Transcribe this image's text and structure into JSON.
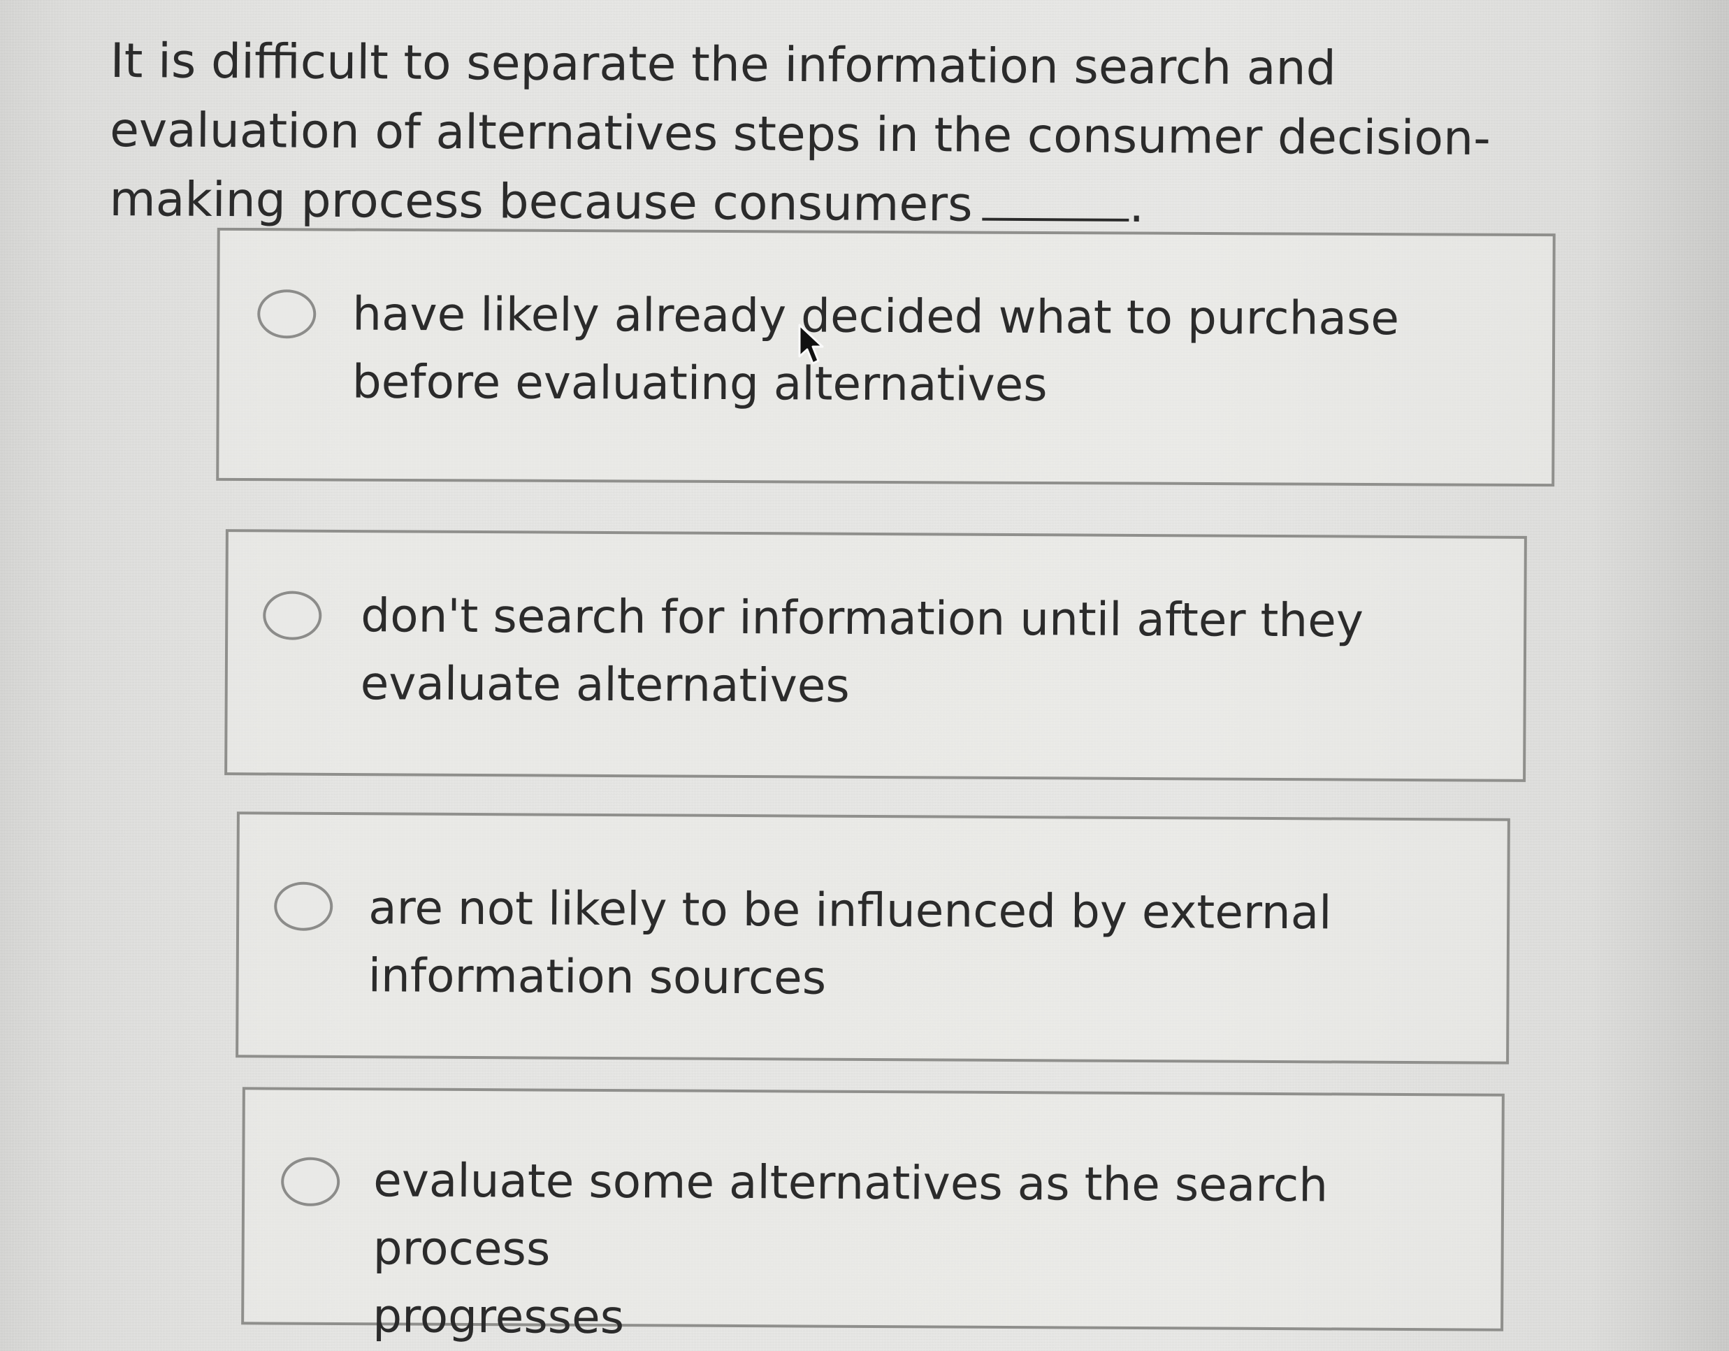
{
  "question": {
    "text": "It is difficult to separate the information search and evaluation of alternatives steps in the consumer decision-making process because consumers",
    "blank_suffix": "."
  },
  "options": [
    {
      "line1": "have likely already decided what to purchase",
      "line2": "before evaluating alternatives"
    },
    {
      "line1": "don't search for information until after they",
      "line2": "evaluate alternatives"
    },
    {
      "line1": "are not likely to be influenced by external",
      "line2": "information sources"
    },
    {
      "line1": "evaluate some alternatives as the search process",
      "line2": "progresses"
    }
  ],
  "icons": {
    "radio": "radio-button-unselected",
    "cursor": "mouse-pointer-icon"
  },
  "colors": {
    "text": "#2b2b2b",
    "border": "#8f8f8c",
    "background": "#e4e4e2"
  }
}
